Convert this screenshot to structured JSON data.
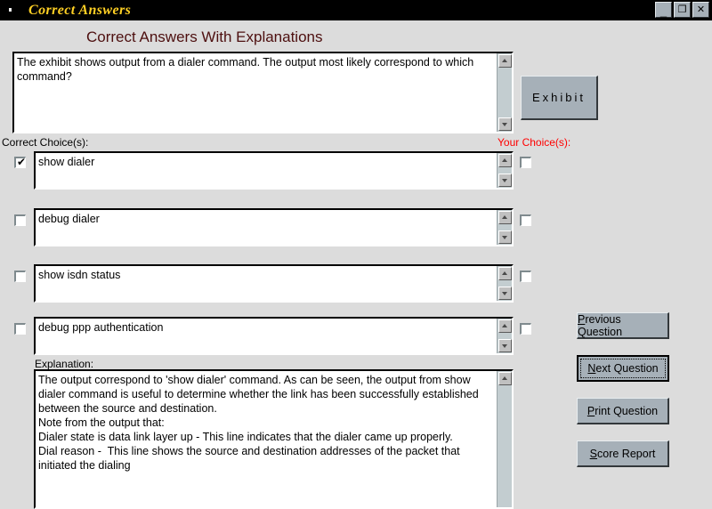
{
  "window": {
    "title": "Correct Answers",
    "controls": {
      "minimize": "_",
      "restore": "❐",
      "close": "✕"
    }
  },
  "header": {
    "page_title": "Correct Answers With Explanations",
    "title_color": "#4d0f0f"
  },
  "question": {
    "text": "The exhibit shows output from a dialer command. The output most likely correspond to which command?",
    "exhibit_button": "Exhibit"
  },
  "columns": {
    "correct_label": "Correct Choice(s):",
    "your_label": "Your Choice(s):",
    "your_label_color": "#ff0000"
  },
  "answers": [
    {
      "text": "show dialer",
      "correct": true,
      "correct_mark": "✔",
      "yours": false,
      "your_mark": ""
    },
    {
      "text": "debug dialer",
      "correct": false,
      "correct_mark": "",
      "yours": false,
      "your_mark": ""
    },
    {
      "text": "show isdn status",
      "correct": false,
      "correct_mark": "",
      "yours": false,
      "your_mark": ""
    },
    {
      "text": "debug ppp authentication",
      "correct": false,
      "correct_mark": "",
      "yours": false,
      "your_mark": ""
    }
  ],
  "explanation": {
    "label": "Explanation:",
    "text": "The output correspond to 'show dialer' command. As can be seen, the output from show dialer command is useful to determine whether the link has been successfully established between the source and destination.\nNote from the output that:\nDialer state is data link layer up - This line indicates that the dialer came up properly.\nDial reason -  This line shows the source and destination addresses of the packet that initiated the dialing"
  },
  "side_buttons": [
    {
      "accel": "P",
      "rest": "revious Question",
      "focused": false
    },
    {
      "accel": "N",
      "rest": "ext Question",
      "focused": true
    },
    {
      "accel": "P",
      "rest": "rint Question",
      "focused": false
    },
    {
      "accel": "S",
      "rest": "core Report",
      "focused": false
    }
  ]
}
